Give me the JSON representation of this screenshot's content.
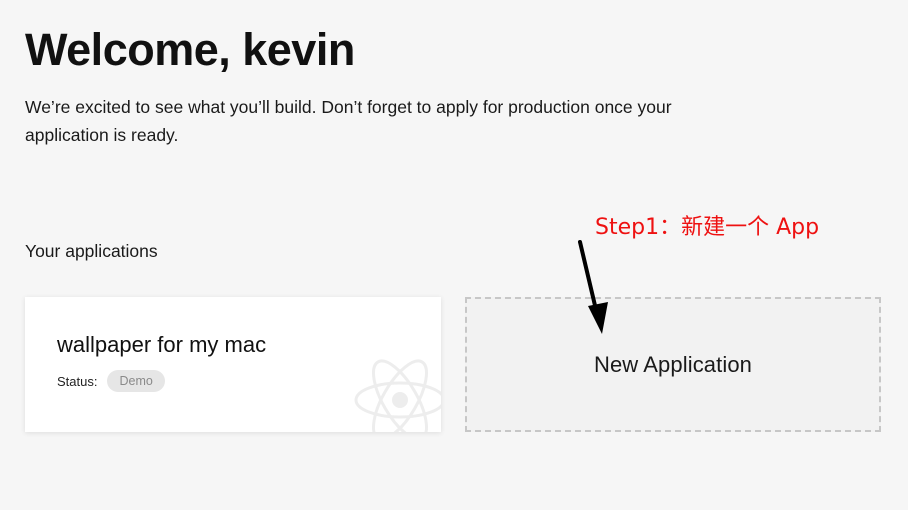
{
  "header": {
    "title": "Welcome, kevin",
    "intro": "We’re excited to see what you’ll build. Don’t forget to apply for production once your application is ready."
  },
  "applications": {
    "section_title": "Your applications",
    "items": [
      {
        "name": "wallpaper for my mac",
        "status_label": "Status:",
        "status": "Demo",
        "icon": "react-atom-icon"
      }
    ],
    "new_application_label": "New Application"
  },
  "annotation": {
    "text": "Step1：新建一个 App",
    "color": "#ee1111",
    "icon": "arrow-down-icon"
  }
}
